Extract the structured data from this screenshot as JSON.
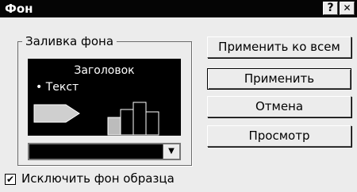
{
  "dialog": {
    "title": "Фон",
    "help_label": "?",
    "close_label": "✕"
  },
  "fill_group": {
    "label": "Заливка фона",
    "preview": {
      "heading": "Заголовок",
      "bullet_text": "• Текст"
    },
    "color_dropdown": {
      "selected_color": "#000000",
      "arrow": "▼"
    }
  },
  "buttons": {
    "apply_all": "Применить ко всем",
    "apply": "Применить",
    "cancel": "Отмена",
    "preview": "Просмотр"
  },
  "omit_background": {
    "label": "Исключить фон образца",
    "checked": true,
    "check_mark": "✔"
  }
}
